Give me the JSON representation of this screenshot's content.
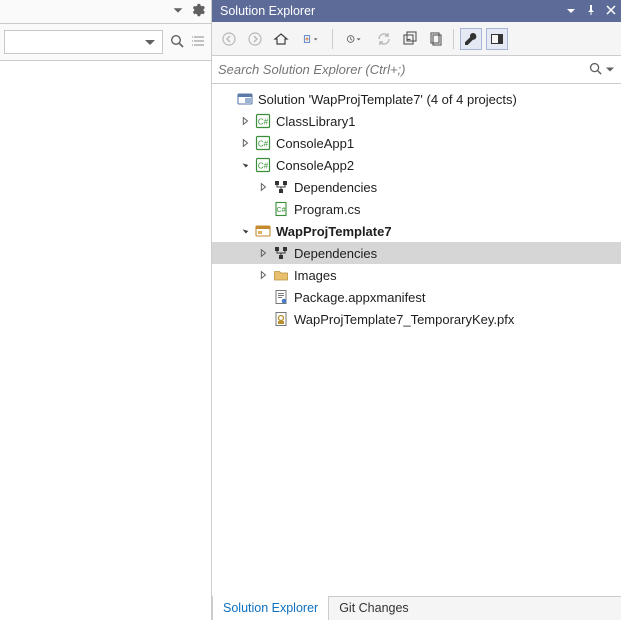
{
  "panel": {
    "title": "Solution Explorer"
  },
  "search": {
    "placeholder": "Search Solution Explorer (Ctrl+;)"
  },
  "tree": {
    "solution_label": "Solution 'WapProjTemplate7' (4 of 4 projects)",
    "items": [
      {
        "indent": 0,
        "expander": "none",
        "icon": "solution",
        "label_key": "tree.solution_label",
        "bold": false,
        "name": "solution-node"
      },
      {
        "indent": 1,
        "expander": "closed",
        "icon": "csproj",
        "label": "ClassLibrary1",
        "bold": false,
        "name": "project-classlibrary1"
      },
      {
        "indent": 1,
        "expander": "closed",
        "icon": "csproj",
        "label": "ConsoleApp1",
        "bold": false,
        "name": "project-consoleapp1"
      },
      {
        "indent": 1,
        "expander": "open",
        "icon": "csproj",
        "label": "ConsoleApp2",
        "bold": false,
        "name": "project-consoleapp2"
      },
      {
        "indent": 2,
        "expander": "closed",
        "icon": "deps",
        "label": "Dependencies",
        "bold": false,
        "name": "consoleapp2-dependencies"
      },
      {
        "indent": 2,
        "expander": "none",
        "icon": "csfile",
        "label": "Program.cs",
        "bold": false,
        "name": "file-program-cs"
      },
      {
        "indent": 1,
        "expander": "open",
        "icon": "wap",
        "label": "WapProjTemplate7",
        "bold": true,
        "name": "project-wapprojtemplate7"
      },
      {
        "indent": 2,
        "expander": "closed",
        "icon": "deps",
        "label": "Dependencies",
        "bold": false,
        "selected": true,
        "name": "wap-dependencies"
      },
      {
        "indent": 2,
        "expander": "closed",
        "icon": "folder",
        "label": "Images",
        "bold": false,
        "name": "folder-images"
      },
      {
        "indent": 2,
        "expander": "none",
        "icon": "manifest",
        "label": "Package.appxmanifest",
        "bold": false,
        "name": "file-appxmanifest"
      },
      {
        "indent": 2,
        "expander": "none",
        "icon": "pfx",
        "label": "WapProjTemplate7_TemporaryKey.pfx",
        "bold": false,
        "name": "file-pfx"
      }
    ]
  },
  "bottom_tabs": {
    "active": "Solution Explorer",
    "inactive": "Git Changes"
  }
}
